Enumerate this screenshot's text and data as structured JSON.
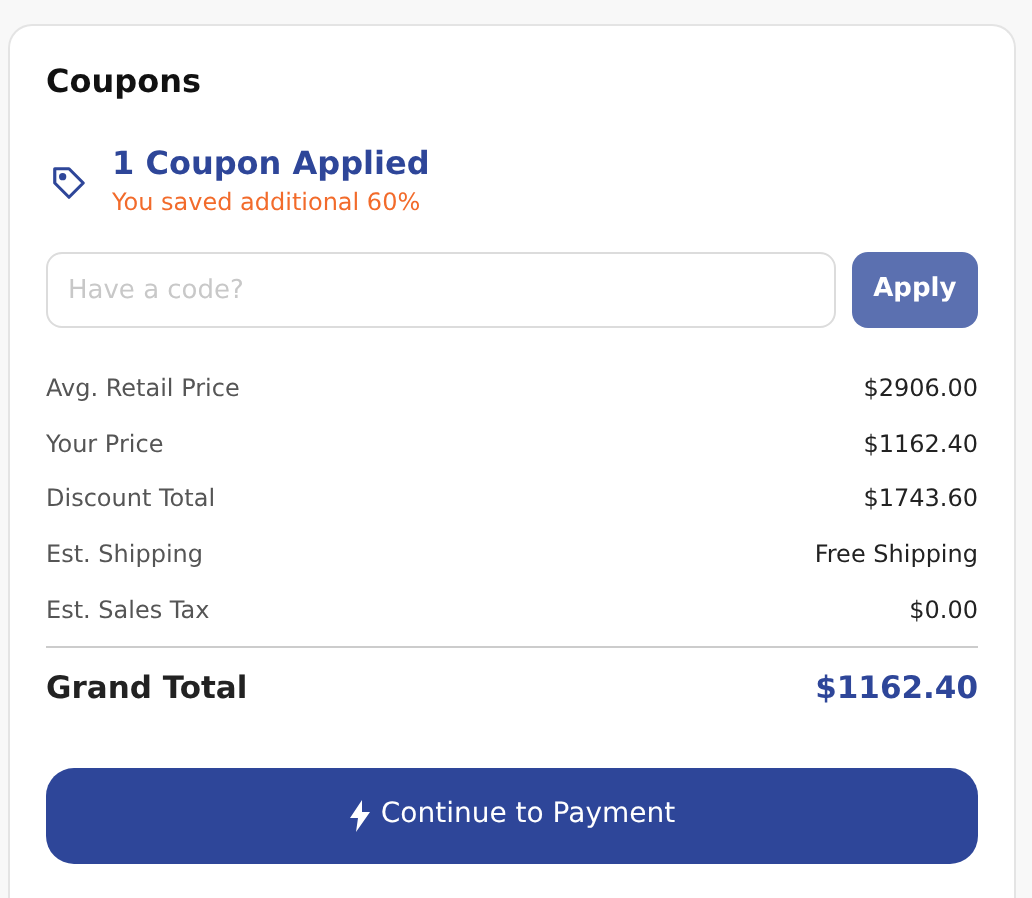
{
  "card": {
    "title": "Coupons"
  },
  "coupon": {
    "headline": "1 Coupon Applied",
    "note": "You saved additional 60%"
  },
  "code_field": {
    "placeholder": "Have a code?"
  },
  "apply_button": {
    "label": "Apply",
    "disabled": true
  },
  "summary": [
    {
      "label": "Avg. Retail Price",
      "value": "$2906.00"
    },
    {
      "label": "Your Price",
      "value": "$1162.40"
    },
    {
      "label": "Discount Total",
      "value": "$1743.60"
    },
    {
      "label": "Est. Shipping",
      "value": "Free Shipping"
    },
    {
      "label": "Est. Sales Tax",
      "value": "$0.00"
    }
  ],
  "grand_total": {
    "label": "Grand Total",
    "value": "$1162.40"
  },
  "pay_button": {
    "label": "Continue to Payment"
  }
}
